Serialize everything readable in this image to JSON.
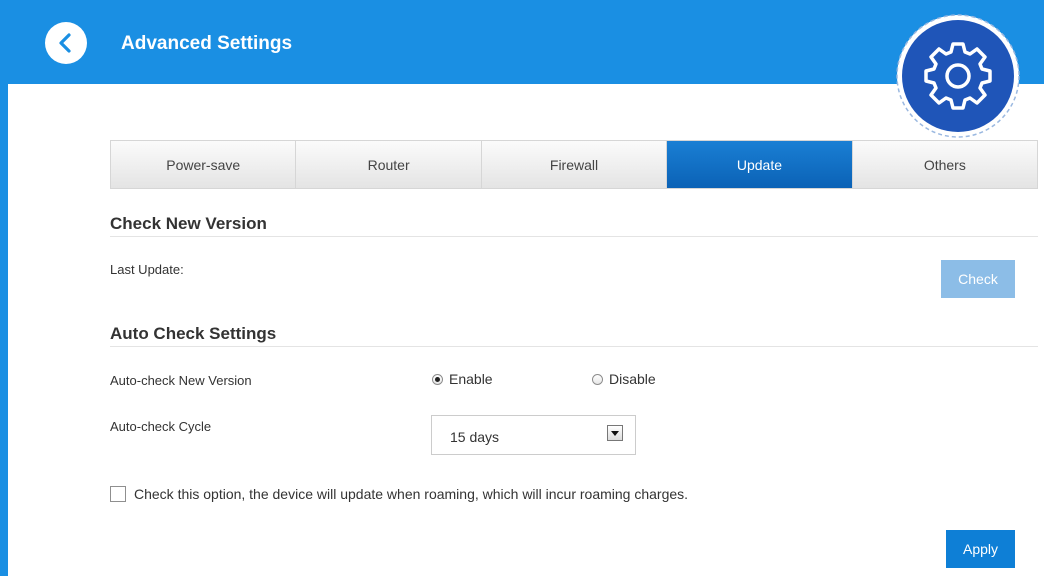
{
  "header": {
    "title": "Advanced Settings",
    "back_icon": "chevron-left-icon",
    "gear_icon": "gear-icon",
    "colors": {
      "header": "#1a8fe3",
      "gear_badge": "#1f55b8"
    }
  },
  "tabs": [
    {
      "label": "Power-save",
      "active": false
    },
    {
      "label": "Router",
      "active": false
    },
    {
      "label": "Firewall",
      "active": false
    },
    {
      "label": "Update",
      "active": true
    },
    {
      "label": "Others",
      "active": false
    }
  ],
  "check_new_version": {
    "title": "Check New Version",
    "last_update_label": "Last Update:",
    "last_update_value": "",
    "check_button": "Check"
  },
  "auto_check": {
    "title": "Auto Check Settings",
    "new_version_label": "Auto-check New Version",
    "enable_label": "Enable",
    "disable_label": "Disable",
    "selected": "Enable",
    "cycle_label": "Auto-check Cycle",
    "cycle_value": "15 days"
  },
  "roaming": {
    "label": "Check this option, the device will update when roaming, which will incur roaming charges.",
    "checked": false
  },
  "apply_button": "Apply"
}
